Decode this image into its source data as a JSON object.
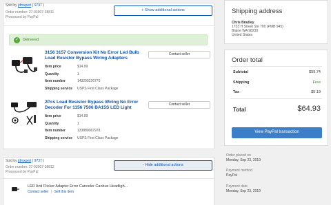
{
  "order1": {
    "sold_by_prefix": "Sold by ",
    "seller": "jdmxpert",
    "feedback": "( 9737 )",
    "order_number": "Order number: 27-03907-38811",
    "processed_by": "Processed by PayPal",
    "toggle_label": "+ Show additional actions",
    "status": "Delivered",
    "items": [
      {
        "title": "3156 3157 Conversion Kit No Error Led Bulb Load Resistor Bypass Wiring Adapters",
        "contact_label": "Contact seller",
        "item_price_label": "Item price",
        "item_price": "$14.99",
        "quantity_label": "Quantity",
        "quantity": "1",
        "item_number_label": "Item number",
        "item_number": "143290226770",
        "shipping_label": "Shipping service",
        "shipping": "USPS First Class Package"
      },
      {
        "title": "2Pcs Load Resistor Bypass Wiring No Error Decoder For 1156 7506 BA15S LED Light",
        "contact_label": "Contact seller",
        "item_price_label": "Item price",
        "item_price": "$14.99",
        "quantity_label": "Quantity",
        "quantity": "1",
        "item_number_label": "Item number",
        "item_number": "133880067978",
        "shipping_label": "Shipping service",
        "shipping": "USPS First Class Package"
      }
    ]
  },
  "order2": {
    "sold_by_prefix": "Sold by ",
    "seller": "jdmxpert",
    "feedback": "( 9737 )",
    "order_number": "Order number: 27-03907-38812",
    "processed_by": "Processed by PayPal",
    "toggle_label": "- Hide additional actions",
    "item_title": "LED Anti Flicker Adapter Error Canceler Canbus Headligh...",
    "contact_link": "Contact seller",
    "separator": "|",
    "see_item_link": "Sell this item"
  },
  "shipping_address": {
    "title": "Shipping address",
    "name": "Chris Bradley",
    "line1": "1733 H Street Ste 700 (PMB 945)",
    "line2": "Blaine WA 98230",
    "country": "United States"
  },
  "order_total": {
    "title": "Order total",
    "subtotal_label": "Subtotal",
    "subtotal": "$59.74",
    "shipping_label": "Shipping",
    "shipping": "Free",
    "tax_label": "Tax",
    "tax": "$5.19",
    "total_label": "Total",
    "total": "$64.93",
    "button_label": "View PayPal transaction"
  },
  "order_info": {
    "placed_label": "Order placed on",
    "placed": "Monday, Sep 23, 2019",
    "payment_method_label": "Payment method",
    "payment_method": "PayPal",
    "payment_date_label": "Payment date",
    "payment_date": "Monday, Sep 23, 2019"
  },
  "colors": {
    "link": "#0654ba",
    "free": "#3b8b2e",
    "delivered_bg": "#dff0d8",
    "primary_button": "#3d7ec8"
  }
}
